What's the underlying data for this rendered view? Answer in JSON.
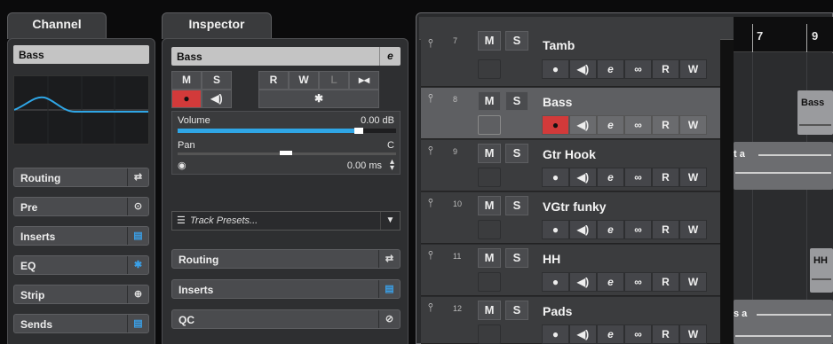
{
  "channel": {
    "tab_label": "Channel",
    "track_name": "Bass",
    "sections": [
      {
        "label": "Routing",
        "icon": "routing-icon",
        "glyph": "⇄"
      },
      {
        "label": "Pre",
        "icon": "pre-power-icon",
        "glyph": "⊙"
      },
      {
        "label": "Inserts",
        "icon": "inserts-icon",
        "glyph": "▤"
      },
      {
        "label": "EQ",
        "icon": "eq-icon",
        "glyph": "✱"
      },
      {
        "label": "Strip",
        "icon": "strip-icon",
        "glyph": "⊕"
      },
      {
        "label": "Sends",
        "icon": "sends-icon",
        "glyph": "▤"
      }
    ]
  },
  "inspector": {
    "tab_label": "Inspector",
    "track_name": "Bass",
    "buttons_top": [
      "M",
      "S",
      "R",
      "W",
      "L"
    ],
    "monitor_icon": "speaker-icon",
    "wildcard": "✱",
    "volume_label": "Volume",
    "volume_value": "0.00 dB",
    "volume_level": 0.82,
    "pan_label": "Pan",
    "pan_value": "C",
    "delay_value": "0.00 ms",
    "track_presets_placeholder": "Track Presets...",
    "sections": [
      {
        "label": "Routing",
        "icon": "routing-icon",
        "glyph": "⇄"
      },
      {
        "label": "Inserts",
        "icon": "inserts-icon",
        "glyph": "▤"
      },
      {
        "label": "QC",
        "icon": "qc-icon",
        "glyph": "⊘"
      }
    ]
  },
  "toolbar": {
    "add_icon": "+",
    "presets_icon": "track-presets-icon"
  },
  "ruler": {
    "marks": [
      "7",
      "9"
    ]
  },
  "tracks": [
    {
      "number": "7",
      "name": "Tamb",
      "selected": false
    },
    {
      "number": "8",
      "name": "Bass",
      "selected": true
    },
    {
      "number": "9",
      "name": "Gtr Hook",
      "selected": false
    },
    {
      "number": "10",
      "name": "VGtr funky",
      "selected": false
    },
    {
      "number": "11",
      "name": "HH",
      "selected": false
    },
    {
      "number": "12",
      "name": "Pads",
      "selected": false
    }
  ],
  "track_controls": {
    "mute": "M",
    "solo": "S",
    "read": "R",
    "write": "W"
  },
  "clips": [
    {
      "label": "Bass"
    },
    {
      "label": "t a"
    },
    {
      "label": "HH"
    },
    {
      "label": "s a"
    }
  ],
  "colors": {
    "accent_blue": "#3aa0e8",
    "record_red": "#d23a3a"
  }
}
